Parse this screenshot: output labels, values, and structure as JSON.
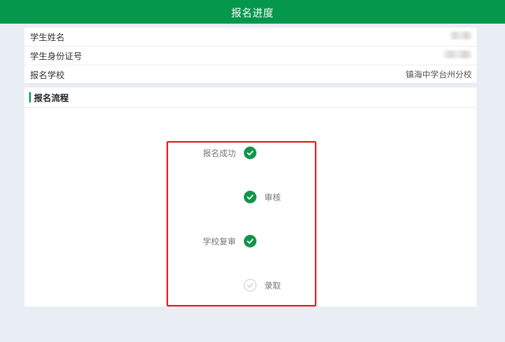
{
  "header": {
    "title": "报名进度"
  },
  "student_info": {
    "rows": [
      {
        "label": "学生姓名",
        "value": ""
      },
      {
        "label": "学生身份证号",
        "value": ""
      },
      {
        "label": "报名学校",
        "value": "镇海中学台州分校"
      }
    ]
  },
  "process": {
    "title": "报名流程",
    "steps": [
      {
        "label": "报名成功",
        "status": "done"
      },
      {
        "label": "审核",
        "status": "done"
      },
      {
        "label": "学校复审",
        "status": "done"
      },
      {
        "label": "录取",
        "status": "pending"
      }
    ]
  },
  "colors": {
    "header_bg": "#05974c",
    "done": "#13944a",
    "pending": "#cfcfcf",
    "highlight": "#e82323"
  }
}
